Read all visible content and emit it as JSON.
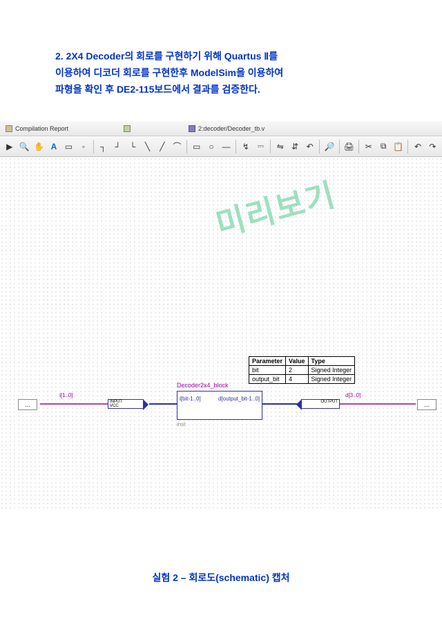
{
  "header": {
    "line1": "2. 2X4 Decoder의 회로를 구현하기 위해 Quartus Ⅱ를",
    "line2": "이용하여 디코더 회로를 구현한후 ModelSim을 이용하여",
    "line3": "파형을 확인 후 DE2-115보드에서 결과를 검증한다."
  },
  "tabs": {
    "t1": "Compilation Report",
    "t2": "",
    "t3": "2:decoder/Decoder_tb.v"
  },
  "watermark": "미리보기",
  "param_table": {
    "headers": {
      "p": "Parameter",
      "v": "Value",
      "t": "Type"
    },
    "rows": [
      {
        "p": "bit",
        "v": "2",
        "t": "Signed Integer"
      },
      {
        "p": "output_bit",
        "v": "4",
        "t": "Signed Integer"
      }
    ]
  },
  "block": {
    "name": "Decoder2x4_block",
    "pin_in": "i[bit-1..0]",
    "pin_out": "d[output_bit-1..0]",
    "inst": "inst"
  },
  "ports": {
    "input_label": "INPUT",
    "input_sub": "VCC",
    "input_sig": "i[1..0]",
    "output_label": "OUTPUT",
    "output_sig": "d[3..0]",
    "stub": "..."
  },
  "caption": "실험 2 – 회로도(schematic) 캡처"
}
